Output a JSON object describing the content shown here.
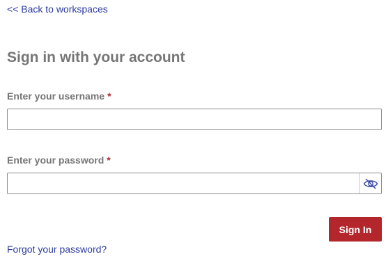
{
  "nav": {
    "back_label": "<< Back to workspaces"
  },
  "form": {
    "title": "Sign in with your account",
    "username": {
      "label": "Enter your username",
      "required_marker": "*",
      "value": "",
      "placeholder": ""
    },
    "password": {
      "label": "Enter your password",
      "required_marker": "*",
      "value": "",
      "placeholder": "",
      "toggle_icon": "eye-slash-icon"
    },
    "submit_label": "Sign In",
    "forgot_label": "Forgot your password?"
  },
  "colors": {
    "link": "#2b3a9e",
    "primary_button": "#b3262c",
    "label_text": "#767676",
    "required": "#b02a30",
    "icon": "#3b4aa8"
  }
}
